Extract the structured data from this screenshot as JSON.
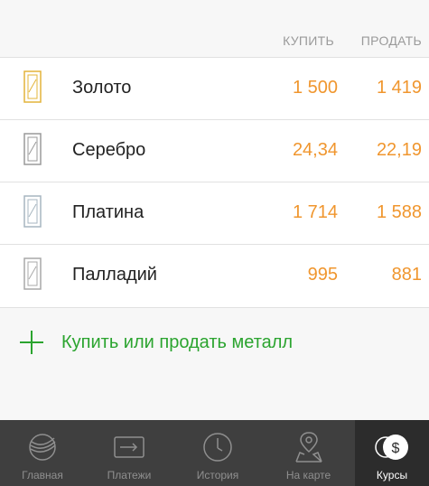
{
  "columns": {
    "buy": "КУПИТЬ",
    "sell": "ПРОДАТЬ"
  },
  "metals": [
    {
      "name": "Золото",
      "buy": "1 500",
      "sell": "1 419",
      "bar_color": "#e3b43a"
    },
    {
      "name": "Серебро",
      "buy": "24,34",
      "sell": "22,19",
      "bar_color": "#9a9a9a"
    },
    {
      "name": "Платина",
      "buy": "1 714",
      "sell": "1 588",
      "bar_color": "#a7b6c0"
    },
    {
      "name": "Палладий",
      "buy": "995",
      "sell": "881",
      "bar_color": "#a9a9a9"
    }
  ],
  "action": {
    "label": "Купить или продать металл",
    "icon": "plus-icon",
    "color": "#2ba42f"
  },
  "price_color": "#f0962e",
  "tabbar": {
    "tabs": [
      {
        "label": "Главная",
        "icon": "sber-logo-icon",
        "active": false
      },
      {
        "label": "Платежи",
        "icon": "card-icon",
        "active": false
      },
      {
        "label": "История",
        "icon": "clock-icon",
        "active": false
      },
      {
        "label": "На карте",
        "icon": "map-pin-icon",
        "active": false
      },
      {
        "label": "Курсы",
        "icon": "dollar-coins-icon",
        "active": true
      }
    ]
  }
}
